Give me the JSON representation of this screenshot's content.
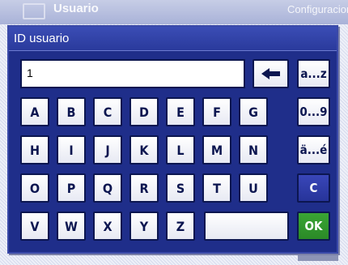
{
  "background": {
    "title": "Usuario",
    "right_label": "Configuracion"
  },
  "dialog": {
    "title": "ID usuario",
    "input_value": "1"
  },
  "keyboard": {
    "row1": [
      "A",
      "B",
      "C",
      "D",
      "E",
      "F",
      "G"
    ],
    "row2": [
      "H",
      "I",
      "J",
      "K",
      "L",
      "M",
      "N"
    ],
    "row3": [
      "O",
      "P",
      "Q",
      "R",
      "S",
      "T",
      "U"
    ],
    "row4": [
      "V",
      "W",
      "X",
      "Y",
      "Z"
    ],
    "backspace_icon": "arrow-left-icon",
    "side": {
      "lower": "a...z",
      "digits": "0...9",
      "special": "ä...é",
      "clear": "C",
      "ok": "OK"
    }
  },
  "colors": {
    "dialog_bg": "#1f2e8a",
    "ok_green": "#3aa534",
    "clear_blue": "#3946b8"
  }
}
